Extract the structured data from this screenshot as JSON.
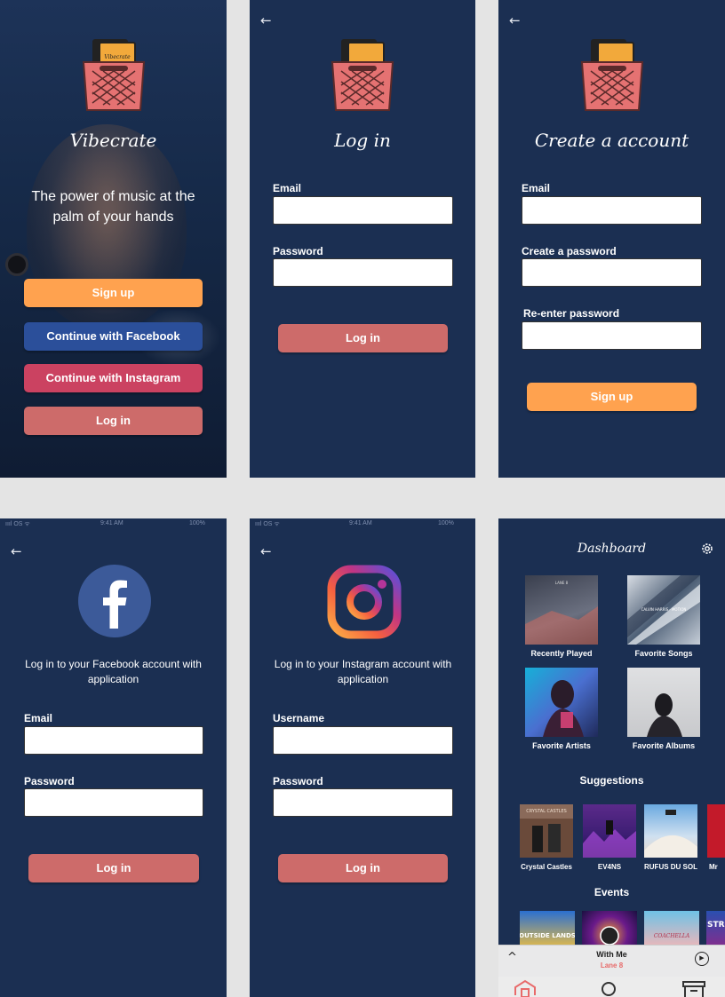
{
  "screen_welcome": {
    "app_name": "Vibecrate",
    "tagline": "The power of music at the palm of your hands",
    "signup_button": "Sign up",
    "facebook_button": "Continue with Facebook",
    "instagram_button": "Continue with Instagram",
    "login_button": "Log in",
    "crate_label": "Vibecrate"
  },
  "screen_login": {
    "back_icon": "←",
    "title": "Log in",
    "email_label": "Email",
    "password_label": "Password",
    "login_button": "Log in"
  },
  "screen_create": {
    "back_icon": "←",
    "title": "Create a account",
    "email_label": "Email",
    "password_label": "Create a password",
    "reenter_label": "Re-enter password",
    "signup_button": "Sign up"
  },
  "screen_facebook": {
    "back_icon": "←",
    "status_carrier": "ıııl OS ᯤ",
    "status_time": "9:41 AM",
    "status_battery": "100%",
    "subtitle": "Log in to your Facebook account with application",
    "email_label": "Email",
    "password_label": "Password",
    "login_button": "Log in"
  },
  "screen_instagram": {
    "back_icon": "←",
    "status_carrier": "ıııl OS ᯤ",
    "status_time": "9:41 AM",
    "status_battery": "100%",
    "subtitle": "Log in to your Instagram account with application",
    "username_label": "Username",
    "password_label": "Password",
    "login_button": "Log in"
  },
  "screen_dashboard": {
    "title": "Dashboard",
    "tiles": [
      {
        "caption": "Recently Played",
        "art_text": "LANE 8"
      },
      {
        "caption": "Favorite Songs",
        "art_text": "CALVIN HARRIS · MOTION"
      },
      {
        "caption": "Favorite Artists",
        "art_text": ""
      },
      {
        "caption": "Favorite Albums",
        "art_text": ""
      }
    ],
    "suggestions_heading": "Suggestions",
    "suggestions": [
      {
        "name": "Crystal Castles",
        "art_text": "CRYSTAL CASTLES"
      },
      {
        "name": "EV4NS",
        "art_text": ""
      },
      {
        "name": "RUFUS DU SOL",
        "art_text": ""
      },
      {
        "name": "Mr",
        "art_text": ""
      }
    ],
    "events_heading": "Events",
    "events": [
      {
        "art_text": "OUTSIDE LANDS"
      },
      {
        "art_text": ""
      },
      {
        "art_text": "COACHELLA"
      },
      {
        "art_text": "STR"
      }
    ],
    "player": {
      "song": "With Me",
      "artist": "Lane 8",
      "chevron_icon": "^",
      "play_icon": "▶"
    }
  },
  "colors": {
    "background": "#1b2f52",
    "orange": "#ffa24f",
    "facebook": "#2b4f9a",
    "instagram": "#cb4261",
    "rose": "#cd6b6a",
    "artist_accent": "#e86a6a"
  }
}
